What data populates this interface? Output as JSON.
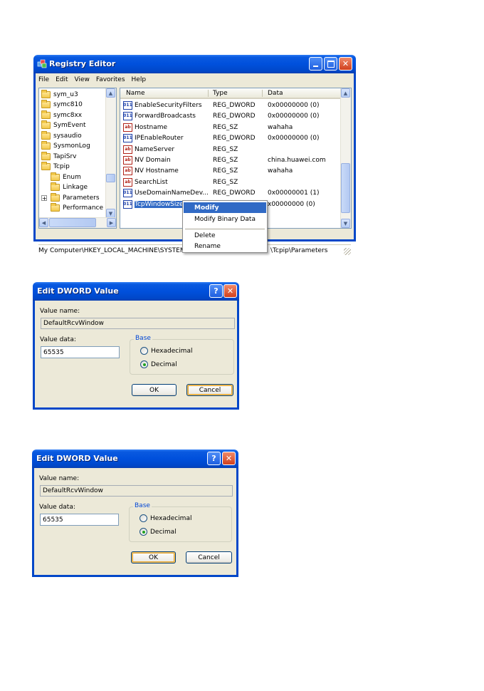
{
  "regedit": {
    "title": "Registry Editor",
    "menu": [
      "File",
      "Edit",
      "View",
      "Favorites",
      "Help"
    ],
    "tree": [
      {
        "label": "sym_u3",
        "indent": 0
      },
      {
        "label": "symc810",
        "indent": 0
      },
      {
        "label": "symc8xx",
        "indent": 0
      },
      {
        "label": "SymEvent",
        "indent": 0
      },
      {
        "label": "sysaudio",
        "indent": 0
      },
      {
        "label": "SysmonLog",
        "indent": 0
      },
      {
        "label": "TapiSrv",
        "indent": 0
      },
      {
        "label": "Tcpip",
        "indent": 0
      },
      {
        "label": "Enum",
        "indent": 1
      },
      {
        "label": "Linkage",
        "indent": 1
      },
      {
        "label": "Parameters",
        "indent": 1,
        "expander": "+"
      },
      {
        "label": "Performance",
        "indent": 1
      }
    ],
    "columns": {
      "name": "Name",
      "type": "Type",
      "data": "Data"
    },
    "rows": [
      {
        "name": "EnableSecurityFilters",
        "type": "REG_DWORD",
        "data": "0x00000000 (0)",
        "icon": "binary-value-icon"
      },
      {
        "name": "ForwardBroadcasts",
        "type": "REG_DWORD",
        "data": "0x00000000 (0)",
        "icon": "binary-value-icon"
      },
      {
        "name": "Hostname",
        "type": "REG_SZ",
        "data": "wahaha",
        "icon": "string-value-icon"
      },
      {
        "name": "IPEnableRouter",
        "type": "REG_DWORD",
        "data": "0x00000000 (0)",
        "icon": "binary-value-icon"
      },
      {
        "name": "NameServer",
        "type": "REG_SZ",
        "data": "",
        "icon": "string-value-icon"
      },
      {
        "name": "NV Domain",
        "type": "REG_SZ",
        "data": "china.huawei.com",
        "icon": "string-value-icon"
      },
      {
        "name": "NV Hostname",
        "type": "REG_SZ",
        "data": "wahaha",
        "icon": "string-value-icon"
      },
      {
        "name": "SearchList",
        "type": "REG_SZ",
        "data": "",
        "icon": "string-value-icon"
      },
      {
        "name": "UseDomainNameDev...",
        "type": "REG_DWORD",
        "data": "0x00000001 (1)",
        "icon": "binary-value-icon"
      },
      {
        "name": "TcpWindowSize",
        "type": "",
        "data": "x00000000 (0)",
        "icon": "binary-value-icon",
        "selected": true
      }
    ],
    "status_left": "My Computer\\HKEY_LOCAL_MACHINE\\SYSTEM",
    "status_right": "\\Tcpip\\Parameters"
  },
  "context_menu": {
    "items": [
      "Modify",
      "Modify Binary Data",
      "Delete",
      "Rename"
    ]
  },
  "dialog1": {
    "title": "Edit DWORD Value",
    "value_name_label": "Value name:",
    "value_name": "DefaultRcvWindow",
    "value_data_label": "Value data:",
    "value_data": "65535",
    "base_label": "Base",
    "hex_label": "Hexadecimal",
    "dec_label": "Decimal",
    "ok": "OK",
    "cancel": "Cancel"
  },
  "dialog2": {
    "title": "Edit DWORD Value",
    "value_name_label": "Value name:",
    "value_name": "DefaultRcvWindow",
    "value_data_label": "Value data:",
    "value_data": "65535",
    "base_label": "Base",
    "hex_label": "Hexadecimal",
    "dec_label": "Decimal",
    "ok": "OK",
    "cancel": "Cancel"
  }
}
